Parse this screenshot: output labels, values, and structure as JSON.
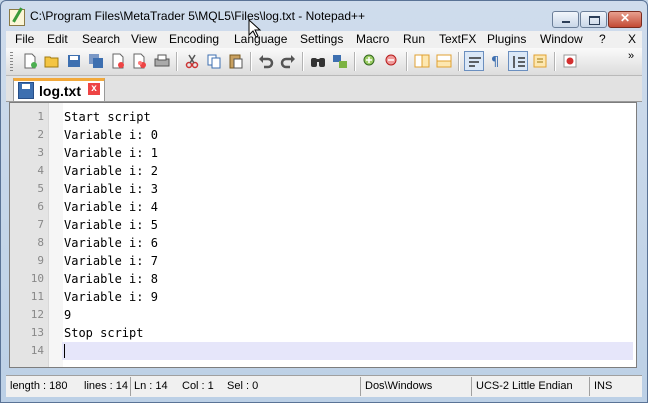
{
  "window": {
    "title": "C:\\Program Files\\MetaTrader 5\\MQL5\\Files\\log.txt - Notepad++"
  },
  "window_controls": {
    "minimize": "",
    "maximize": "",
    "close": "✕"
  },
  "menu": {
    "items": [
      "File",
      "Edit",
      "Search",
      "View",
      "Encoding",
      "Language",
      "Settings",
      "Macro",
      "Run",
      "TextFX",
      "Plugins",
      "Window",
      "?"
    ],
    "close_doc": "X"
  },
  "toolbar": {
    "buttons": [
      "new-file",
      "open-file",
      "save",
      "save-all",
      "close",
      "close-all",
      "print",
      "cut",
      "copy",
      "paste",
      "undo",
      "redo",
      "find",
      "replace",
      "zoom-in",
      "zoom-out",
      "sync-vertical",
      "sync-horizontal",
      "word-wrap",
      "show-all-chars",
      "indent-guide",
      "user-defined-lang",
      "record-macro"
    ],
    "overflow": "»"
  },
  "tabs": [
    {
      "label": "log.txt",
      "close": "x",
      "active": true
    }
  ],
  "editor": {
    "lines": [
      "Start script",
      "Variable i: 0",
      "Variable i: 1",
      "Variable i: 2",
      "Variable i: 3",
      "Variable i: 4",
      "Variable i: 5",
      "Variable i: 6",
      "Variable i: 7",
      "Variable i: 8",
      "Variable i: 9",
      "9",
      "Stop script",
      ""
    ],
    "line_numbers": [
      "1",
      "2",
      "3",
      "4",
      "5",
      "6",
      "7",
      "8",
      "9",
      "10",
      "11",
      "12",
      "13",
      "14"
    ],
    "current_line": 14
  },
  "status": {
    "length": "length : 180",
    "lines": "lines : 14",
    "ln": "Ln : 14",
    "col": "Col : 1",
    "sel": "Sel : 0",
    "eol": "Dos\\Windows",
    "encoding": "UCS-2 Little Endian",
    "mode": "INS"
  },
  "colors": {
    "tab_accent": "#f2a93b",
    "current_line": "#e6e6fa",
    "close_button": "#c34a34"
  }
}
